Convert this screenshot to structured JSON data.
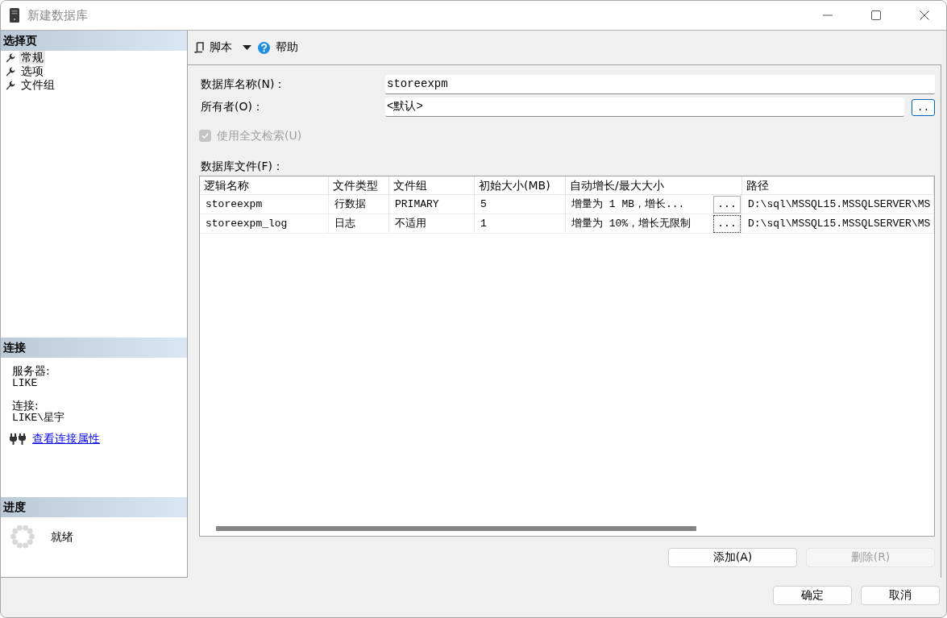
{
  "window": {
    "title": "新建数据库"
  },
  "select_page": {
    "header": "选择页",
    "items": [
      {
        "label": "常规",
        "selected": true
      },
      {
        "label": "选项",
        "selected": false
      },
      {
        "label": "文件组",
        "selected": false
      }
    ]
  },
  "connection": {
    "header": "连接",
    "server_label": "服务器:",
    "server": "LIKE",
    "connection_label": "连接:",
    "connection": "LIKE\\星宇",
    "link": "查看连接属性"
  },
  "progress": {
    "header": "进度",
    "status": "就绪"
  },
  "toolbar": {
    "script": "脚本",
    "help": "帮助"
  },
  "form": {
    "name": {
      "label": "数据库名称(N)：",
      "value": "storeexpm"
    },
    "owner": {
      "label": "所有者(O)：",
      "value": "<默认>",
      "button": ".."
    },
    "fulltext": {
      "label": "使用全文检索(U)",
      "checked": true,
      "disabled": true
    }
  },
  "files": {
    "label": "数据库文件(F)：",
    "columns": [
      "逻辑名称",
      "文件类型",
      "文件组",
      "初始大小(MB)",
      "自动增长/最大大小",
      "路径"
    ],
    "rows": [
      {
        "cells": [
          "storeexpm",
          "行数据",
          "PRIMARY",
          "5",
          "增量为 1 MB，增长...",
          "D:\\sql\\MSSQL15.MSSQLSERVER\\MS"
        ],
        "button": "...",
        "focused": false
      },
      {
        "cells": [
          "storeexpm_log",
          "日志",
          "不适用",
          "1",
          "增量为 10%，增长无限制",
          "D:\\sql\\MSSQL15.MSSQLSERVER\\MS"
        ],
        "button": "...",
        "focused": true
      }
    ]
  },
  "file_buttons": [
    {
      "label": "添加(A)",
      "disabled": false
    },
    {
      "label": "删除(R)",
      "disabled": true
    }
  ],
  "dialog_buttons": [
    {
      "label": "确定"
    },
    {
      "label": "取消"
    }
  ]
}
